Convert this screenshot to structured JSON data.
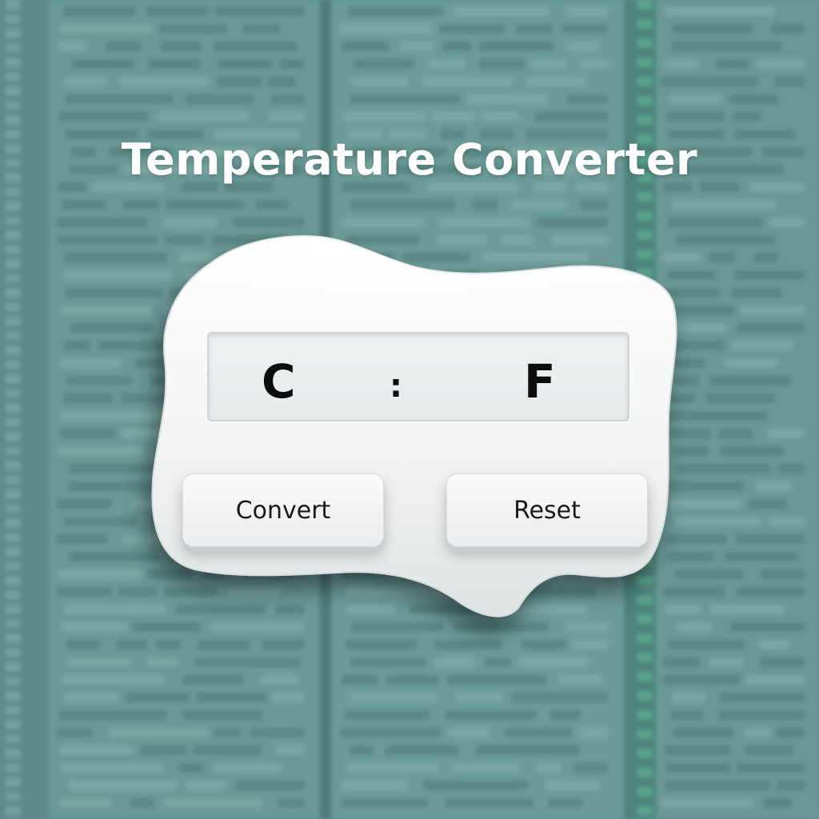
{
  "app": {
    "title": "Temperature Converter"
  },
  "display": {
    "left_unit": "C",
    "separator": ":",
    "right_unit": "F"
  },
  "buttons": {
    "convert_label": "Convert",
    "reset_label": "Reset"
  },
  "colors": {
    "background_teal": "#6a9996",
    "widget_white": "#f4f5f5",
    "title_text": "#ffffff",
    "display_bg": "#eef1f2",
    "button_text": "#1a1a1a"
  }
}
